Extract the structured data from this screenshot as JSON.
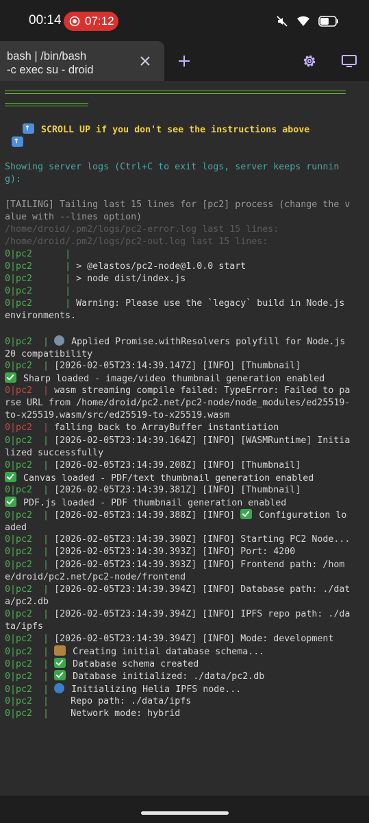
{
  "status_bar": {
    "time": "00:14",
    "recording_time": "07:12",
    "icons": [
      "mute-icon",
      "wifi-icon",
      "battery-icon"
    ]
  },
  "tabs": [
    {
      "title": "bash | /bin/bash\n-c exec su - droid"
    }
  ],
  "toolbar": {
    "icons": [
      "close-icon",
      "plus-icon",
      "gear-icon",
      "monitor-icon"
    ]
  },
  "colors": {
    "background": "#2c2c2c",
    "accent_green": "#4caf50",
    "error_red": "#c64545",
    "warning_yellow": "#f2d13d",
    "info_cyan": "#4aa6a6"
  },
  "terminal": {
    "scroll_notice": " SCROLL UP if you don't see the instructions above",
    "logs_header": "Showing server logs (Ctrl+C to exit logs, server keeps running):",
    "tailing": "[TAILING] Tailing last 15 lines for [pc2] process (change the value with --lines option)",
    "error_log_path": "/home/droid/.pm2/logs/pc2-error.log last 15 lines:",
    "out_log_path": "/home/droid/.pm2/logs/pc2-out.log last 15 lines:",
    "prefix": "0|pc2",
    "pipe": "|",
    "out_lines": [
      "",
      "> @elastos/pc2-node@1.0.0 start",
      "> node dist/index.js",
      "",
      "Warning: Please use the `legacy` build in Node.js environments."
    ],
    "entries": [
      {
        "stream": "out",
        "emoji": "wrench",
        "text": "Applied Promise.withResolvers polyfill for Node.js 20 compatibility"
      },
      {
        "stream": "out",
        "emoji": "",
        "text": "[2026-02-05T23:14:39.147Z] [INFO] [Thumbnail]"
      },
      {
        "stream": "out",
        "emoji": "check",
        "text": "Sharp loaded - image/video thumbnail generation enabled",
        "continuation": true
      },
      {
        "stream": "err",
        "emoji": "",
        "text": "wasm streaming compile failed: TypeError: Failed to parse URL from /home/droid/pc2.net/pc2-node/node_modules/ed25519-to-x25519.wasm/src/ed25519-to-x25519.wasm"
      },
      {
        "stream": "err",
        "emoji": "",
        "text": "falling back to ArrayBuffer instantiation"
      },
      {
        "stream": "out",
        "emoji": "",
        "text": "[2026-02-05T23:14:39.164Z] [INFO] [WASMRuntime] Initialized successfully"
      },
      {
        "stream": "out",
        "emoji": "",
        "text": "[2026-02-05T23:14:39.208Z] [INFO] [Thumbnail]"
      },
      {
        "stream": "out",
        "emoji": "check",
        "text": "Canvas loaded - PDF/text thumbnail generation enabled",
        "continuation": true
      },
      {
        "stream": "out",
        "emoji": "",
        "text": "[2026-02-05T23:14:39.381Z] [INFO] [Thumbnail]"
      },
      {
        "stream": "out",
        "emoji": "check",
        "text": "PDF.js loaded - PDF thumbnail generation enabled",
        "continuation": true
      },
      {
        "stream": "out",
        "emoji": "",
        "text": "[2026-02-05T23:14:39.388Z] [INFO] ",
        "emoji_after": "check",
        "text_after": "Configuration loaded"
      },
      {
        "stream": "out",
        "emoji": "",
        "text": "[2026-02-05T23:14:39.390Z] [INFO] Starting PC2 Node..."
      },
      {
        "stream": "out",
        "emoji": "",
        "text": "[2026-02-05T23:14:39.393Z] [INFO] Port: 4200"
      },
      {
        "stream": "out",
        "emoji": "",
        "text": "[2026-02-05T23:14:39.393Z] [INFO] Frontend path: /home/droid/pc2.net/pc2-node/frontend"
      },
      {
        "stream": "out",
        "emoji": "",
        "text": "[2026-02-05T23:14:39.394Z] [INFO] Database path: ./data/pc2.db"
      },
      {
        "stream": "out",
        "emoji": "",
        "text": "[2026-02-05T23:14:39.394Z] [INFO] IPFS repo path: ./data/ipfs"
      },
      {
        "stream": "out",
        "emoji": "",
        "text": "[2026-02-05T23:14:39.394Z] [INFO] Mode: development"
      },
      {
        "stream": "out",
        "emoji": "package",
        "text": "Creating initial database schema..."
      },
      {
        "stream": "out",
        "emoji": "check",
        "text": "Database schema created"
      },
      {
        "stream": "out",
        "emoji": "check",
        "text": "Database initialized: ./data/pc2.db"
      },
      {
        "stream": "out",
        "emoji": "globe",
        "text": "Initializing Helia IPFS node..."
      },
      {
        "stream": "out",
        "emoji": "",
        "text": "   Repo path: ./data/ipfs"
      },
      {
        "stream": "out",
        "emoji": "",
        "text": "   Network mode: hybrid"
      }
    ]
  }
}
